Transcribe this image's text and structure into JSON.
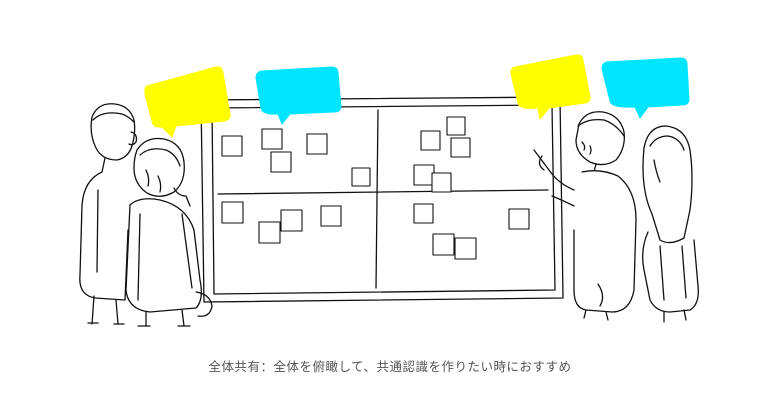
{
  "caption": "全体共有：全体を俯瞰して、共通認識を作りたい時におすすめ",
  "colors": {
    "bubble_yellow": "#FFFF00",
    "bubble_cyan": "#00E5FF",
    "ink": "#111111",
    "caption_text": "#555555",
    "background": "#FFFFFF"
  },
  "icons": {
    "whiteboard": "whiteboard-icon",
    "speech_bubble": "speech-bubble-icon",
    "sticky_note": "sticky-note-icon",
    "person": "person-icon"
  }
}
